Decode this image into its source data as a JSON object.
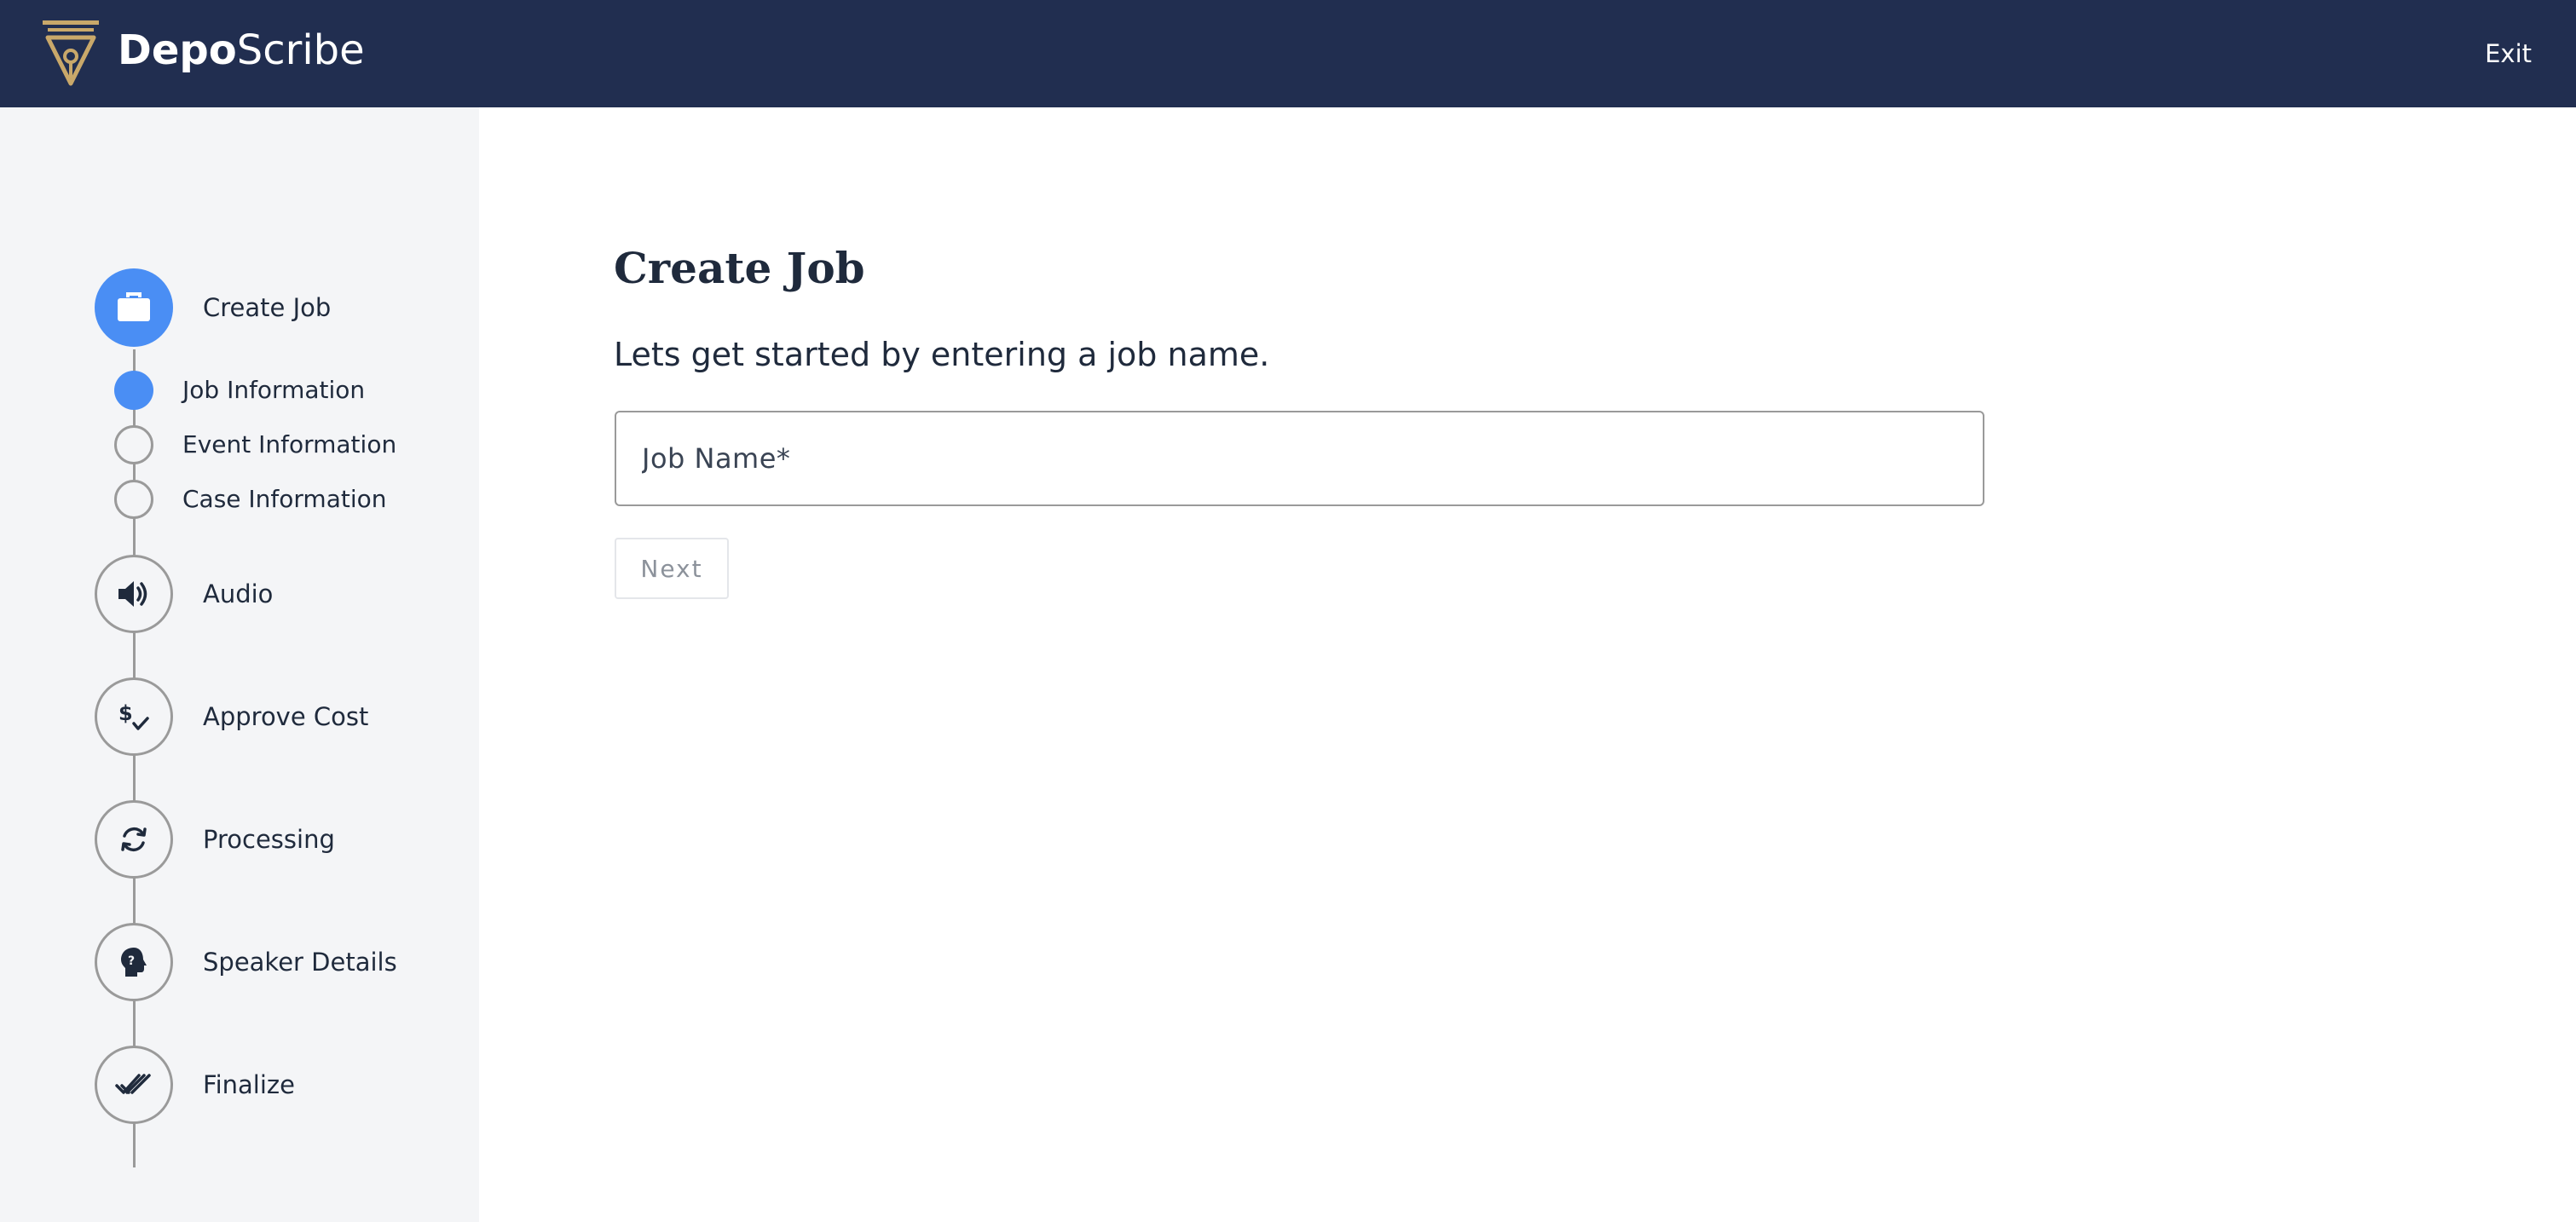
{
  "app": {
    "brand_bold": "Depo",
    "brand_regular": "Scribe",
    "exit_label": "Exit"
  },
  "colors": {
    "header_bg": "#212e50",
    "accent": "#4a8ef4",
    "logo_gold": "#c9a86a",
    "sidebar_bg": "#f4f5f7"
  },
  "sidebar": {
    "steps": [
      {
        "label": "Create Job",
        "icon": "briefcase-icon",
        "active": true
      },
      {
        "label": "Audio",
        "icon": "speaker-icon",
        "active": false
      },
      {
        "label": "Approve Cost",
        "icon": "dollar-check-icon",
        "active": false
      },
      {
        "label": "Processing",
        "icon": "sync-icon",
        "active": false
      },
      {
        "label": "Speaker Details",
        "icon": "head-question-icon",
        "active": false
      },
      {
        "label": "Finalize",
        "icon": "double-check-icon",
        "active": false
      }
    ],
    "substeps": [
      {
        "label": "Job Information",
        "active": true
      },
      {
        "label": "Event Information",
        "active": false
      },
      {
        "label": "Case Information",
        "active": false
      }
    ]
  },
  "main": {
    "title": "Create Job",
    "subtitle": "Lets get started by entering a job name.",
    "job_name_placeholder": "Job Name*",
    "job_name_value": "",
    "next_label": "Next"
  }
}
